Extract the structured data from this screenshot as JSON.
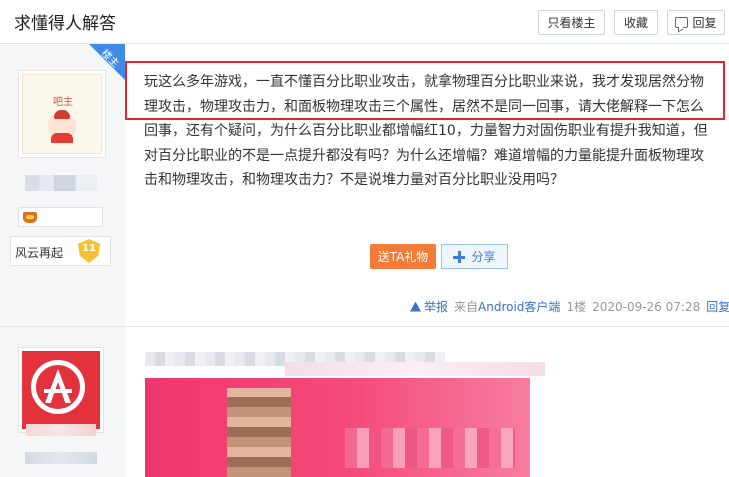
{
  "header": {
    "title": "求懂得人解答",
    "buttons": {
      "only_op": "只看楼主",
      "favorite": "收藏",
      "reply": "回复"
    }
  },
  "post1": {
    "op_tag": "楼主",
    "avatar_tag": "吧主",
    "level_name": "风云再起",
    "level_number": "11",
    "body": "玩这么多年游戏，一直不懂百分比职业攻击，就拿物理百分比职业来说，我才发现居然分物理攻击，物理攻击力，和面板物理攻击三个属性，居然不是同一回事，请大佬解释一下怎么回事，还有个疑问，为什么百分比职业都增幅红10，力量智力对固伤职业有提升我知道，但对百分比职业的不是一点提升都没有吗？为什么还增幅？难道增幅的力量能提升面板物理攻击和物理攻击，和物理攻击力？不是说堆力量对百分比职业没用吗？",
    "gift_button": "送TA礼物",
    "share_button": "分享",
    "meta": {
      "report": "举报",
      "source_prefix": "来自",
      "source": "Android客户端",
      "floor": "1楼",
      "time": "2020-09-26 07:28",
      "reply": "回复"
    }
  },
  "colors": {
    "accent_blue": "#3a72c6",
    "gift_orange": "#f27b3a",
    "highlight_red": "#e4262a",
    "op_corner_blue": "#3d8be6"
  }
}
